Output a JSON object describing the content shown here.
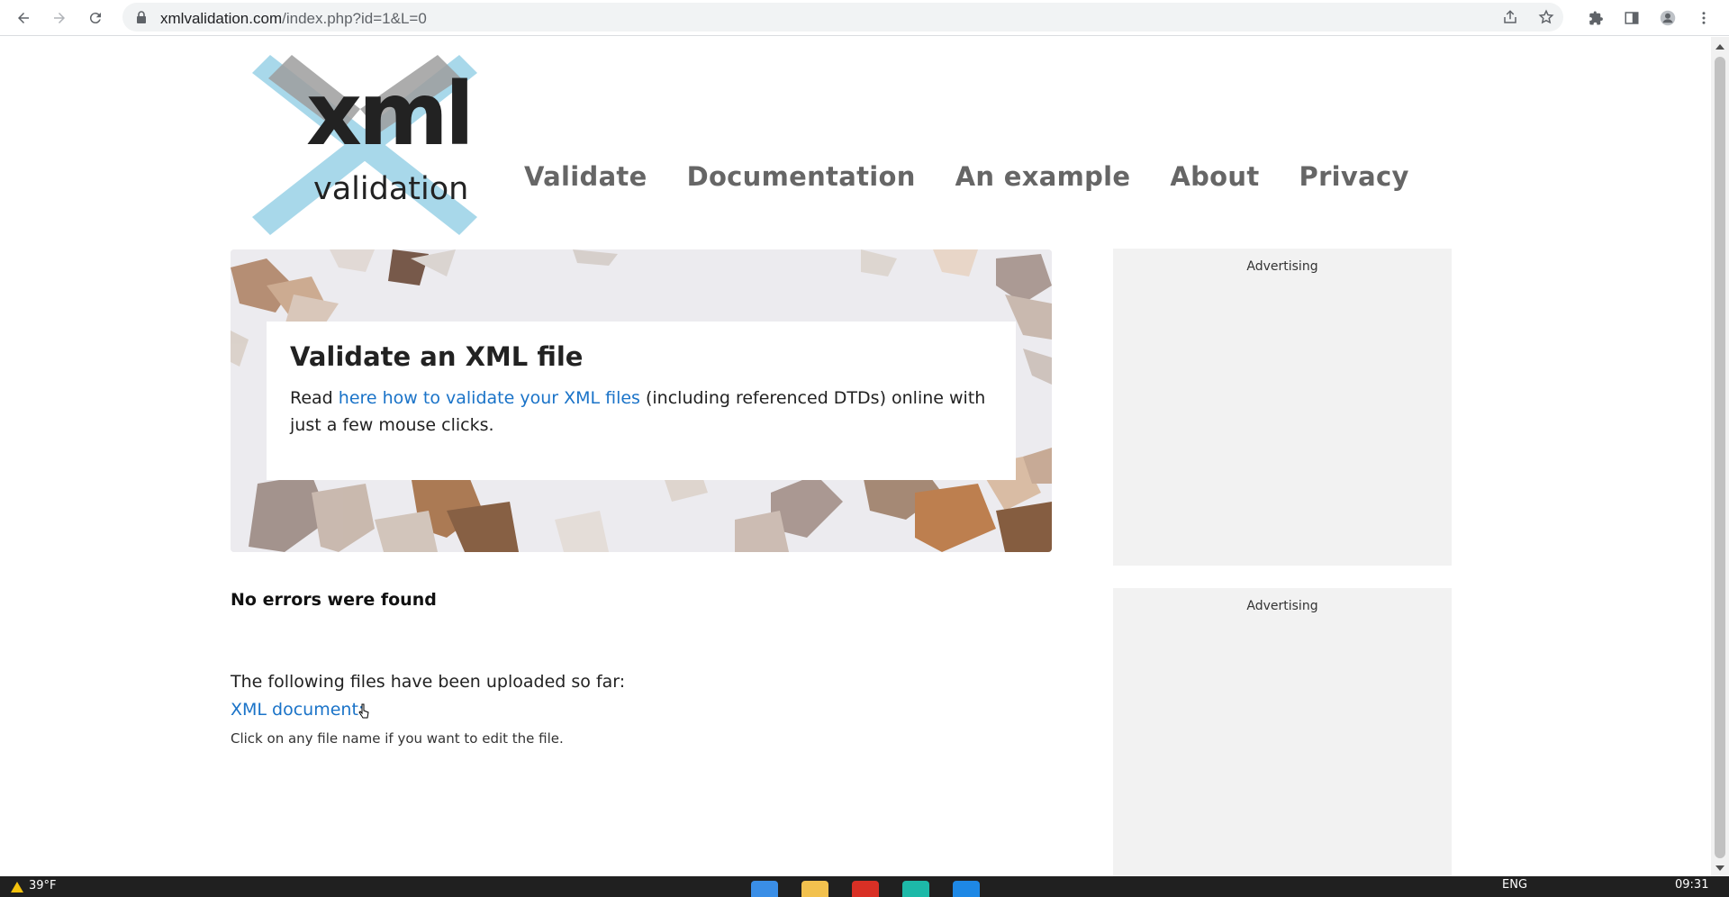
{
  "browser": {
    "url_host": "xmlvalidation.com",
    "url_path": "/index.php?id=1&L=0"
  },
  "site": {
    "logo": {
      "line1": "xml",
      "line2": "validation"
    },
    "nav": [
      {
        "label": "Validate"
      },
      {
        "label": "Documentation"
      },
      {
        "label": "An example"
      },
      {
        "label": "About"
      },
      {
        "label": "Privacy"
      }
    ]
  },
  "hero": {
    "title": "Validate an XML file",
    "text_before": "Read ",
    "link_text": "here how to validate your XML files",
    "text_after": " (including referenced DTDs) online with just a few mouse clicks."
  },
  "result": {
    "status": "No errors were found",
    "uploaded_intro": "The following files have been uploaded so far:",
    "file_link": "XML document:",
    "hint": "Click on any file name if you want to edit the file."
  },
  "ads": {
    "label1": "Advertising",
    "label2": "Advertising"
  },
  "taskbar": {
    "weather": "39°F",
    "language": "ENG",
    "time": "09:31"
  },
  "colors": {
    "link": "#1a73c8",
    "nav": "#666666",
    "logo_cross": "#a8d8ea",
    "ad_bg": "#f2f2f2"
  }
}
